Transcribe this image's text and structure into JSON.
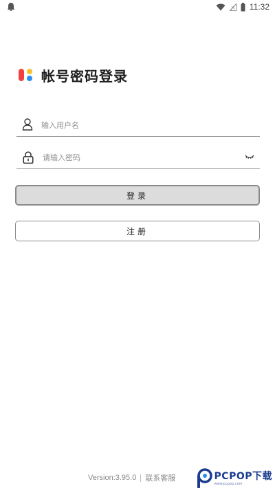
{
  "status_bar": {
    "time": "11:32",
    "icons": [
      "notification-icon",
      "wifi-icon",
      "signal-icon",
      "battery-icon"
    ]
  },
  "header": {
    "logo_icon": "app-logo-icon",
    "title": "帐号密码登录"
  },
  "form": {
    "username": {
      "icon": "user-icon",
      "placeholder": "输入用户名",
      "value": ""
    },
    "password": {
      "icon": "lock-icon",
      "placeholder": "请输入密码",
      "value": "",
      "toggle_icon": "eye-closed-icon"
    }
  },
  "buttons": {
    "login_label": "登录",
    "register_label": "注册"
  },
  "footer": {
    "version": "Version:3.95.0",
    "support_link": "联系客服"
  },
  "watermark": {
    "text": "PCPOP下载",
    "subtext": "www.pcpop.com"
  },
  "colors": {
    "logo_red": "#f0413e",
    "logo_yellow": "#f6c12a",
    "logo_blue": "#2b8ff0",
    "login_button_bg": "#dcdcdc",
    "border": "#8a8a8a",
    "watermark_blue": "#1b3b8f"
  }
}
